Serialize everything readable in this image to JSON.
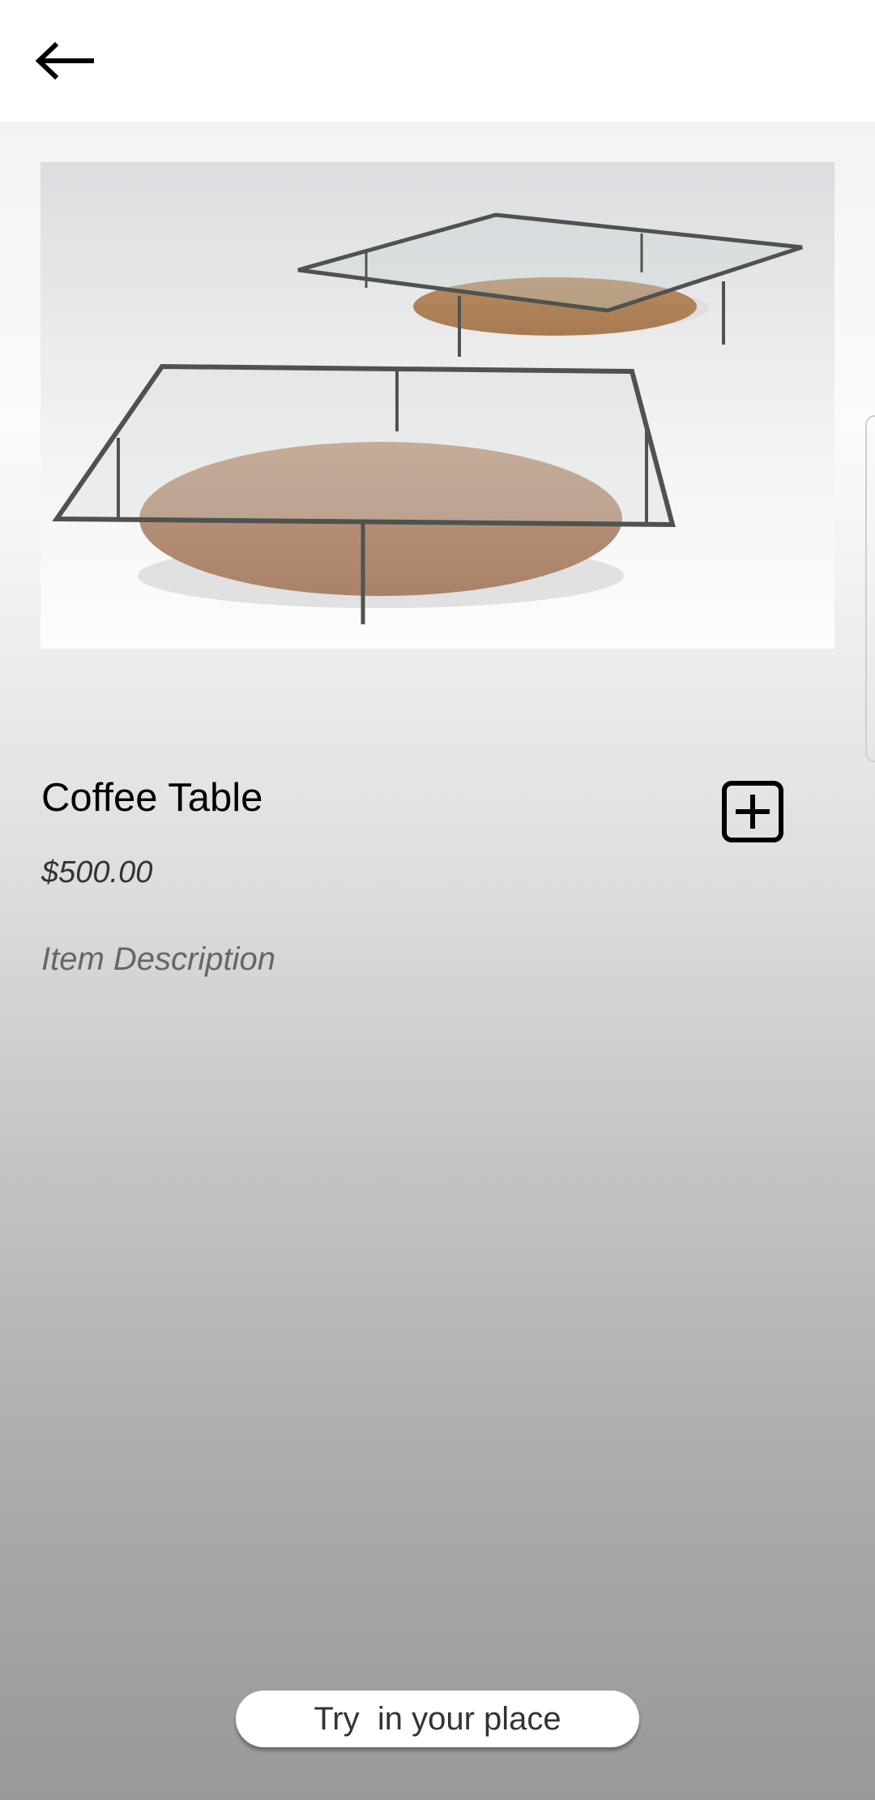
{
  "header": {
    "back_icon": "arrow-left-icon"
  },
  "product": {
    "name": "Coffee Table",
    "price": "$500.00",
    "description": "Item Description",
    "image_icon": "coffee-table-image",
    "add_icon": "plus-square-icon"
  },
  "actions": {
    "try_label": "Try  in your place"
  },
  "colors": {
    "background_top": "#f3f3f3",
    "background_bottom": "#999999",
    "wood": "#b58e6f",
    "glass_frame": "#4f5350"
  }
}
